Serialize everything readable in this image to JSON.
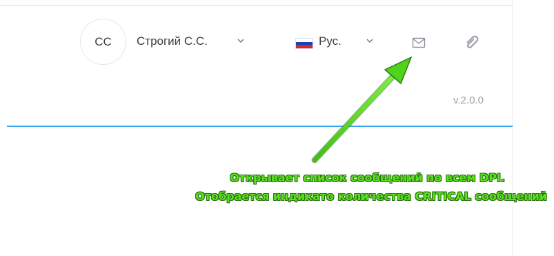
{
  "header": {
    "user": {
      "initials": "CC",
      "name": "Строгий С.С."
    },
    "language": {
      "label": "Рус.",
      "flag_colors": [
        "#ffffff",
        "#1d3fb8",
        "#d52b1e"
      ]
    },
    "icons": {
      "messages": "mail-icon",
      "attachments": "paperclip-icon"
    },
    "version": "v.2.0.0"
  },
  "annotation": {
    "line1": "Открывает список сообщений по всем DPI.",
    "line2": "Отобрается индикато количества CRITICAL сообщений",
    "color": "#57e21d"
  },
  "colors": {
    "accent_line": "#38a8f2",
    "text": "#3b3f45",
    "muted": "#9aa0a6"
  }
}
